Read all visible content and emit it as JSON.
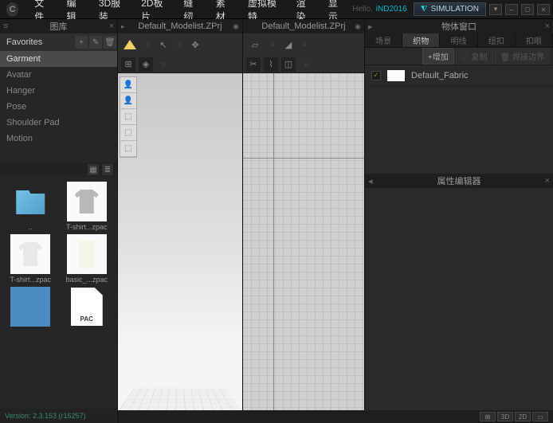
{
  "menu": {
    "items": [
      "文件",
      "编辑",
      "3D服装",
      "2D板片",
      "缝纫",
      "素材",
      "虚拟模特",
      "渲染",
      "显示"
    ],
    "hello": "Hello,",
    "username": "iND2016",
    "simulation": "SIMULATION"
  },
  "library": {
    "title": "图库",
    "categories": [
      "Favorites",
      "Garment",
      "Avatar",
      "Hanger",
      "Pose",
      "Shoulder Pad",
      "Motion"
    ],
    "activeIndex": 1,
    "thumbs": {
      "0": {
        "label": ".."
      },
      "1": {
        "label": "T-shirt...zpac"
      },
      "2": {
        "label": "T-shirt...zpac"
      },
      "3": {
        "label": "basic_...zpac"
      },
      "4": {
        "label": ""
      },
      "5": {
        "label": "PAC"
      }
    },
    "version": "Version: 2.3.153   (r16257)"
  },
  "viewport3d": {
    "title": "Default_Modelist.ZPrj"
  },
  "viewport2d": {
    "title": "Default_Modelist.ZPrj"
  },
  "objects": {
    "title": "物体窗口",
    "tabs": [
      "场景",
      "织物",
      "明线",
      "纽扣",
      "扣眼"
    ],
    "activeTab": 1,
    "btn_add": "+增加",
    "btn_copy": "⿻ 复制",
    "btn_del": "🗑 焊接边界",
    "fabric": "Default_Fabric"
  },
  "editor": {
    "title": "属性编辑器"
  },
  "status": {
    "b1": "⊞",
    "b2": "3D",
    "b3": "2D",
    "b4": "▭"
  }
}
